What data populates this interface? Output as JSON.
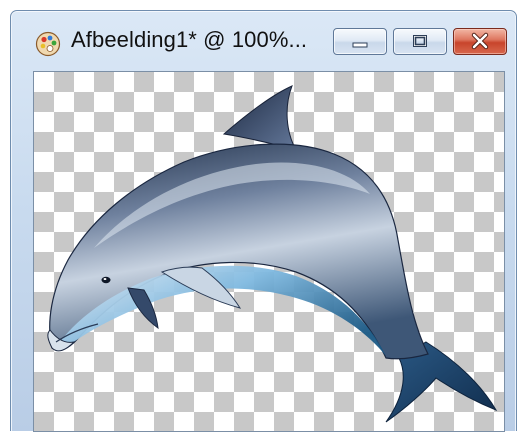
{
  "window": {
    "title": "Afbeelding1* @ 100%...",
    "zoom": "100%",
    "app_icon": "paint-palette-icon",
    "controls": {
      "minimize_icon": "minimize-icon",
      "maximize_icon": "maximize-icon",
      "close_icon": "close-icon",
      "close_color": "#c8452c"
    }
  },
  "canvas": {
    "background": "transparency-checkerboard",
    "checker_colors": [
      "#ffffff",
      "#c8c8c8"
    ],
    "image": "dolphin-icon"
  }
}
